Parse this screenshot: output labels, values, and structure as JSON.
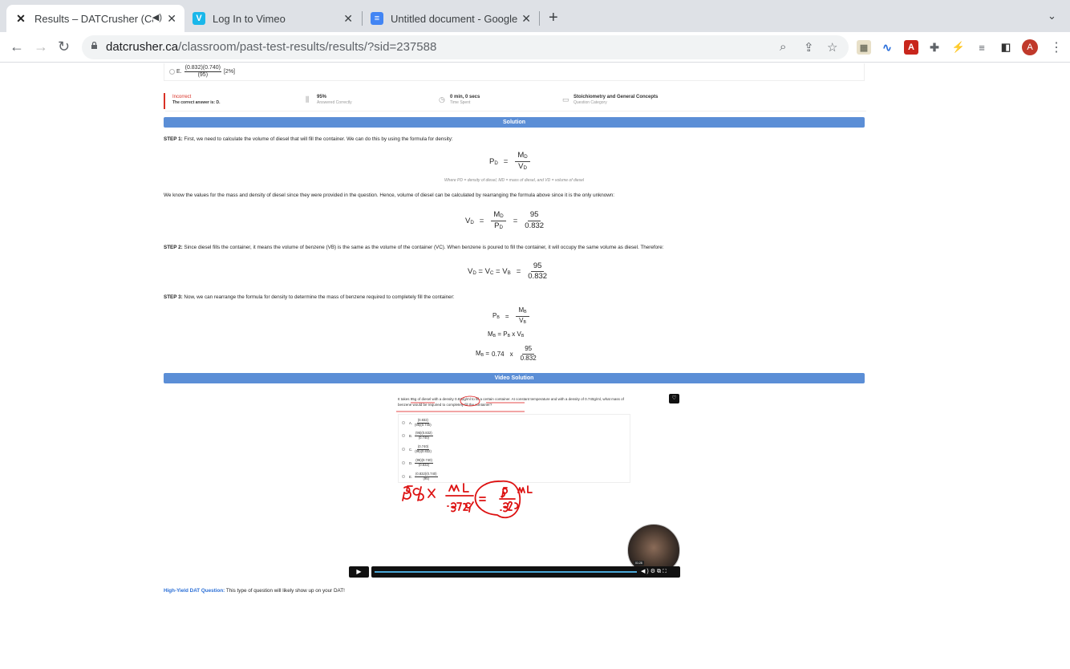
{
  "browser": {
    "tabs": [
      {
        "title": "Results – DATCrusher (Can",
        "favicon": "datcrusher-icon",
        "active": true,
        "audio": true
      },
      {
        "title": "Log In to Vimeo",
        "favicon": "vimeo-icon",
        "active": false
      },
      {
        "title": "Untitled document - Google Do",
        "favicon": "google-docs-icon",
        "active": false
      }
    ],
    "url_domain": "datcrusher.ca",
    "url_path": "/classroom/past-test-results/results/?sid=237588",
    "avatar_letter": "A"
  },
  "question": {
    "option_e": {
      "letter": "E.",
      "numerator": "(0.832)(0.740)",
      "denominator": "(95)",
      "percent": "[2%]"
    }
  },
  "status": {
    "result": "Incorrect",
    "correct_answer": "The correct answer is: D.",
    "percent_value": "95%",
    "percent_label": "Answered Correctly",
    "time_value": "0 min, 0 secs",
    "time_label": "Time Spent",
    "category_value": "Stoichiometry and General Concepts",
    "category_label": "Question Category",
    "result_color": "#d93025"
  },
  "solution": {
    "header": "Solution",
    "step1_label": "STEP 1:",
    "step1_text": " First, we need to calculate the volume of diesel that will fill the container.  We can do this by using the formula for density:",
    "caption": "Where P",
    "caption_full": "Where PD = density of diesel, MD = mass of diesel, and VD = volume of diesel",
    "para2": "We know the values for the mass and density of diesel since they were provided in the question. Hence, volume of diesel can be calculated by rearranging the formula above since it is the only unknown:",
    "step2_label": "STEP 2:",
    "step2_text": " Since diesel fills the container, it means the volume of benzene (VB) is the same as the volume of the container (VC). When benzene is poured to fill the container, it will occupy the same volume as diesel. Therefore:",
    "step3_label": "STEP 3:",
    "step3_text": " Now, we can rearrange the formula for density to determine the mass of benzene required to completely fill the container:",
    "num_95": "95",
    "num_0832": "0.832",
    "num_074": "0.74",
    "times": "x"
  },
  "video": {
    "header": "Video Solution",
    "question_text": "It takes 95g of diesel with a density 0.832g/ml to fill a certain container. At constant temperature and with a density of 0.740g/ml, what mass of benzene would be required to completely fill the container?",
    "options": [
      {
        "letter": "A.",
        "n": "(0.832)",
        "d": "(95)(0.740)"
      },
      {
        "letter": "B.",
        "n": "(95)(0.832)",
        "d": "(0.740)"
      },
      {
        "letter": "C.",
        "n": "(0.740)",
        "d": "(95)(0.832)"
      },
      {
        "letter": "D.",
        "n": "(95)(0.740)",
        "d": "(0.832)"
      },
      {
        "letter": "E.",
        "n": "(0.832)(0.740)",
        "d": "(95)"
      }
    ],
    "timestamp": "01:28",
    "progress": 0.86
  },
  "footer": {
    "highlight": "High-Yield DAT Question:",
    "text": " This type of question will likely show up on your DAT!"
  }
}
